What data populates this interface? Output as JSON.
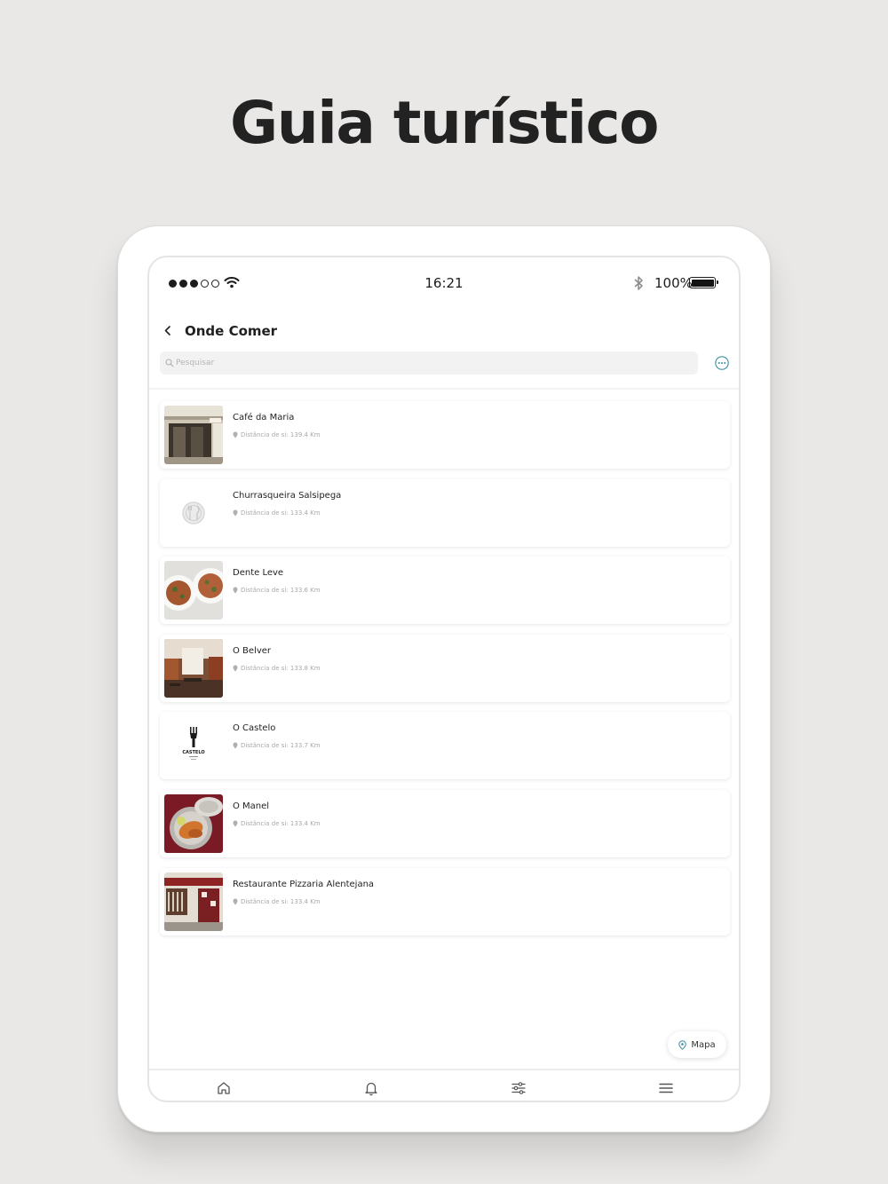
{
  "headline": "Guia turístico",
  "status": {
    "time": "16:21",
    "battery": "100%"
  },
  "header": {
    "title": "Onde Comer"
  },
  "search": {
    "placeholder": "Pesquisar"
  },
  "accent_color": "#3a8fa3",
  "items": [
    {
      "name": "Café da Maria",
      "distance": "Distância de si: 139.4 Km",
      "thumb": "building-photo"
    },
    {
      "name": "Churrasqueira Salsipega",
      "distance": "Distância de si: 133.4 Km",
      "thumb": "cutlery-placeholder"
    },
    {
      "name": "Dente Leve",
      "distance": "Distância de si: 133.6 Km",
      "thumb": "pizza-photo"
    },
    {
      "name": "O Belver",
      "distance": "Distância de si: 133.8 Km",
      "thumb": "interior-photo"
    },
    {
      "name": "O Castelo",
      "distance": "Distância de si: 133.7 Km",
      "thumb": "castelo-logo",
      "logo_text": "CASTELO"
    },
    {
      "name": "O Manel",
      "distance": "Distância de si: 133.4 Km",
      "thumb": "fish-dish-photo"
    },
    {
      "name": "Restaurante Pizzaria Alentejana",
      "distance": "Distância de si: 133.4 Km",
      "thumb": "storefront-photo"
    }
  ],
  "map_button": {
    "label": "Mapa"
  },
  "tabbar": {
    "icons": [
      "home-icon",
      "bell-icon",
      "sliders-icon",
      "menu-icon"
    ]
  }
}
